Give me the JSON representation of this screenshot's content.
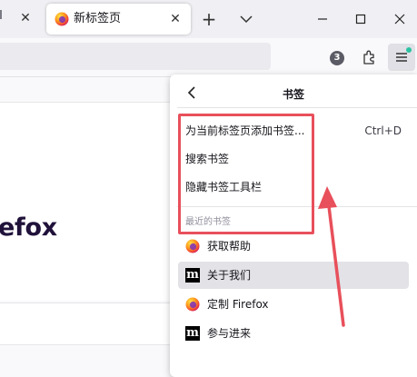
{
  "browser": {
    "tab": {
      "title": "新标签页"
    },
    "new_tab_symbol": "+",
    "close_symbol": "✕",
    "extension_badge_count": "3",
    "menu_notification_color": "#2ac3a2"
  },
  "page": {
    "brand_fragment": "efox"
  },
  "bookmarks_panel": {
    "title": "书签",
    "items": [
      {
        "label": "为当前标签页添加书签...",
        "shortcut": "Ctrl+D"
      },
      {
        "label": "搜索书签"
      },
      {
        "label": "隐藏书签工具栏"
      }
    ],
    "recent_section_label": "最近的书签",
    "recent": [
      {
        "label": "获取帮助",
        "icon": "firefox-icon"
      },
      {
        "label": "关于我们",
        "icon": "mdn-icon"
      },
      {
        "label": "定制 Firefox",
        "icon": "firefox-icon"
      },
      {
        "label": "参与进来",
        "icon": "mdn-icon"
      }
    ],
    "mdn_glyph": "m"
  },
  "annotation": {
    "color": "#e8505b"
  }
}
